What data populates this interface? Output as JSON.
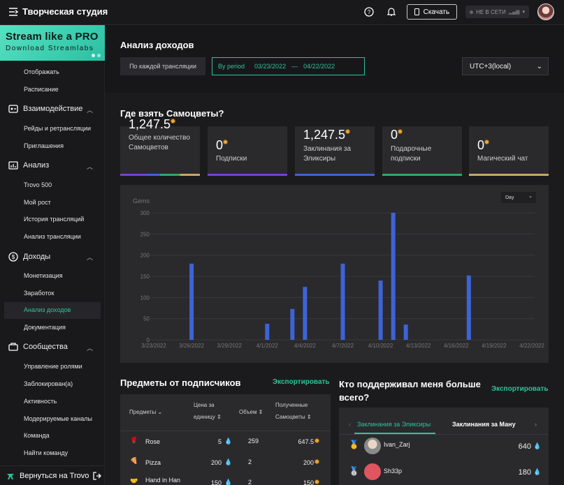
{
  "topbar": {
    "title": "Творческая студия",
    "download_label": "Скачать",
    "status_label": "НЕ В СЕТИ"
  },
  "promo": {
    "title": "Stream like a PRO",
    "subtitle": "Download Streamlabs"
  },
  "sidebar": {
    "items_top": [
      "Отображать",
      "Расписание"
    ],
    "section_interaction": "Взаимодействие",
    "interaction_items": [
      "Рейды и ретрансляции",
      "Приглашения"
    ],
    "section_analytics": "Анализ",
    "analytics_items": [
      "Trovo 500",
      "Мой рост",
      "История трансляций",
      "Анализ трансляции"
    ],
    "section_income": "Доходы",
    "income_items": [
      "Монетизация",
      "Заработок",
      "Анализ доходов",
      "Документация"
    ],
    "section_communities": "Сообщества",
    "community_items": [
      "Управление ролями",
      "Заблокирован(а)",
      "Активность",
      "Модерируемые каналы",
      "Команда",
      "Найти команду"
    ],
    "back_label": "Вернуться на Trovo"
  },
  "page": {
    "title": "Анализ доходов",
    "per_stream_label": "По каждой трансляции",
    "by_period_label": "By period",
    "date_from": "03/23/2022",
    "date_sep": "—",
    "date_to": "04/22/2022",
    "timezone": "UTC+3(local)"
  },
  "gems_section": {
    "title": "Где взять Самоцветы?",
    "cards": [
      {
        "value": "1,247.5",
        "label": "Общее количество Самоцветов",
        "color": "#7a3fd1"
      },
      {
        "value": "0",
        "label": "Подписки",
        "color": "#7a3fd1"
      },
      {
        "value": "1,247.5",
        "label": "Заклинания за Эликсиры",
        "color": "#3e63d6"
      },
      {
        "value": "0",
        "label": "Подарочные подписки",
        "color": "#2fa86b"
      },
      {
        "value": "0",
        "label": "Магический чат",
        "color": "#c9a76b"
      }
    ]
  },
  "chart_data": {
    "type": "bar",
    "ylabel": "Gems",
    "period_select": "Day",
    "ylim": [
      0,
      300
    ],
    "yticks": [
      0,
      50,
      100,
      150,
      200,
      250,
      300
    ],
    "xtick_labels": [
      "3/23/2022",
      "3/26/2022",
      "3/29/2022",
      "4/1/2022",
      "4/4/2022",
      "4/7/2022",
      "4/10/2022",
      "4/13/2022",
      "4/16/2022",
      "4/19/2022",
      "4/22/2022"
    ],
    "categories": [
      "3/23",
      "3/24",
      "3/25",
      "3/26",
      "3/27",
      "3/28",
      "3/29",
      "3/30",
      "3/31",
      "4/1",
      "4/2",
      "4/3",
      "4/4",
      "4/5",
      "4/6",
      "4/7",
      "4/8",
      "4/9",
      "4/10",
      "4/11",
      "4/12",
      "4/13",
      "4/14",
      "4/15",
      "4/16",
      "4/17",
      "4/18",
      "4/19",
      "4/20",
      "4/21",
      "4/22"
    ],
    "values": [
      0,
      0,
      0,
      180,
      0,
      0,
      0,
      0,
      0,
      38,
      0,
      73,
      125,
      0,
      0,
      180,
      0,
      0,
      140,
      300,
      36,
      0,
      0,
      0,
      0,
      152,
      0,
      0,
      0,
      0,
      0
    ],
    "color": "#3e63d6"
  },
  "subscriber_items": {
    "title": "Предметы от подписчиков",
    "export_label": "Экспортировать",
    "headers": [
      "Предметы",
      "Цена за единицу",
      "Объем",
      "Полученные Самоцветы"
    ],
    "rows": [
      {
        "name": "Rose",
        "price": "5",
        "volume": "259",
        "gems": "647.5"
      },
      {
        "name": "Pizza",
        "price": "200",
        "volume": "2",
        "gems": "200"
      },
      {
        "name": "Hand in Han",
        "price": "150",
        "volume": "2",
        "gems": "150"
      }
    ]
  },
  "supporters": {
    "title": "Кто поддерживал меня больше всего?",
    "export_label": "Экспортировать",
    "tabs": [
      "Заклинания за Эликсиры",
      "Заклинания за Ману"
    ],
    "rows": [
      {
        "name": "Ivan_Zarj",
        "value": "640"
      },
      {
        "name": "Sh33p",
        "value": "180"
      }
    ]
  }
}
